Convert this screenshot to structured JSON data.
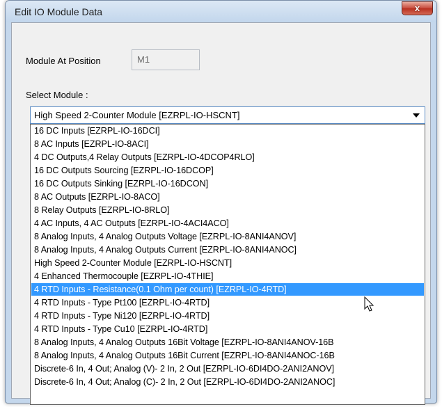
{
  "dialog": {
    "title": "Edit IO Module Data",
    "close_glyph": "x"
  },
  "position": {
    "label": "Module At Position",
    "value": "M1"
  },
  "select": {
    "label": "Select Module :",
    "value": "High Speed 2-Counter Module [EZRPL-IO-HSCNT]"
  },
  "options": [
    "16 DC Inputs [EZRPL-IO-16DCI]",
    "8 AC Inputs [EZRPL-IO-8ACI]",
    "4 DC Outputs,4 Relay Outputs [EZRPL-IO-4DCOP4RLO]",
    "16 DC Outputs Sourcing [EZRPL-IO-16DCOP]",
    "16 DC Outputs Sinking [EZRPL-IO-16DCON]",
    "8 AC Outputs [EZRPL-IO-8ACO]",
    "8 Relay Outputs [EZRPL-IO-8RLO]",
    "4 AC Inputs, 4 AC Outputs [EZRPL-IO-4ACI4ACO]",
    "8 Analog Inputs, 4 Analog Outputs Voltage [EZRPL-IO-8ANI4ANOV]",
    "8 Analog Inputs, 4 Analog Outputs Current [EZRPL-IO-8ANI4ANOC]",
    "High Speed 2-Counter Module [EZRPL-IO-HSCNT]",
    "4 Enhanced Thermocouple [EZRPL-IO-4THIE]",
    "4 RTD Inputs - Resistance(0.1 Ohm per count) [EZRPL-IO-4RTD]",
    "4 RTD Inputs - Type Pt100 [EZRPL-IO-4RTD]",
    "4 RTD Inputs - Type Ni120 [EZRPL-IO-4RTD]",
    "4 RTD Inputs - Type Cu10 [EZRPL-IO-4RTD]",
    "8 Analog Inputs, 4 Analog Outputs 16Bit Voltage [EZRPL-IO-8ANI4ANOV-16B",
    "8 Analog Inputs, 4 Analog Outputs 16Bit Current [EZRPL-IO-8ANI4ANOC-16B",
    "Discrete-6 In, 4 Out; Analog (V)- 2 In, 2 Out [EZRPL-IO-6DI4DO-2ANI2ANOV]",
    "Discrete-6 In, 4 Out; Analog (C)- 2 In, 2 Out [EZRPL-IO-6DI4DO-2ANI2ANOC]"
  ],
  "highlighted_option": "4 RTD Inputs - Resistance(0.1 Ohm per count) [EZRPL-IO-4RTD]",
  "colors": {
    "highlight": "#3399ff",
    "close_button": "#c7493a"
  },
  "icons": {
    "close": "close-icon",
    "dropdown": "chevron-down-icon",
    "cursor": "mouse-pointer-icon"
  }
}
